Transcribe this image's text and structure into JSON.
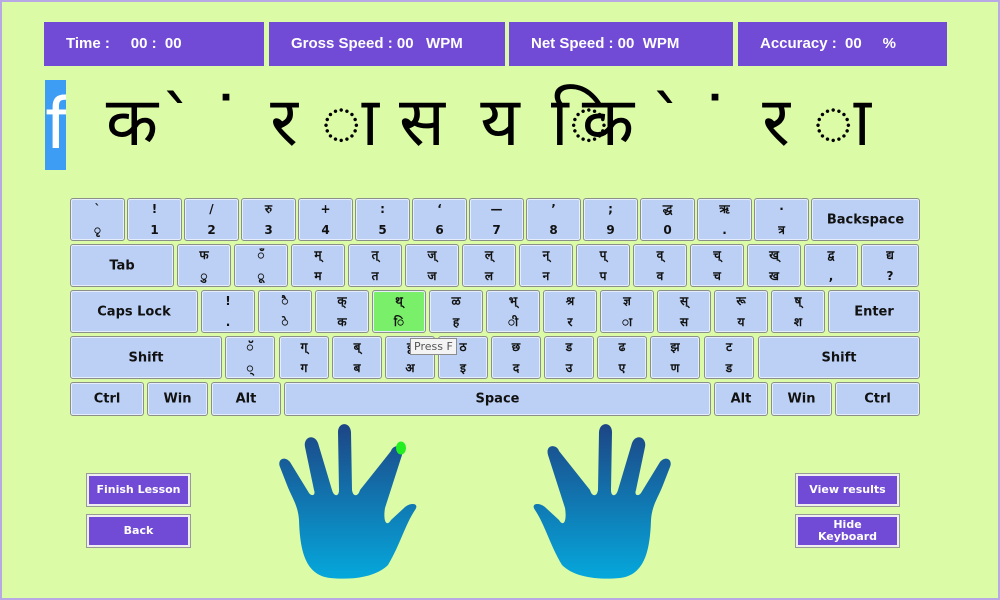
{
  "stats": {
    "time": "Time :     00 :  00",
    "gross_speed": "Gross Speed : 00   WPM",
    "net_speed": "Net Speed : 00  WPM",
    "accuracy": "Accuracy :  00     %"
  },
  "lesson": {
    "current_char": "f",
    "chars": [
      "क",
      "`",
      "˙",
      "र",
      "ा",
      "स",
      "य",
      "ि",
      "क",
      "`",
      "˙",
      "र",
      "ा"
    ]
  },
  "keyboard": {
    "highlighted_key": "थ्/ि",
    "rows": [
      [
        [
          "`",
          "ृ"
        ],
        [
          "!",
          "1"
        ],
        [
          "/",
          "2"
        ],
        [
          "रु",
          "3"
        ],
        [
          "+",
          "4"
        ],
        [
          ":",
          "5"
        ],
        [
          "‘",
          "6"
        ],
        [
          "—",
          "7"
        ],
        [
          "’",
          "8"
        ],
        [
          ";",
          "9"
        ],
        [
          "द्ध",
          "0"
        ],
        [
          "ऋ",
          "."
        ],
        [
          "·",
          "त्र"
        ],
        [
          "Backspace"
        ]
      ],
      [
        [
          "Tab"
        ],
        [
          "फ",
          "ु"
        ],
        [
          "ँ",
          "ू"
        ],
        [
          "म्",
          "म"
        ],
        [
          "त्",
          "त"
        ],
        [
          "ज्",
          "ज"
        ],
        [
          "ल्",
          "ल"
        ],
        [
          "न्",
          "न"
        ],
        [
          "प्",
          "प"
        ],
        [
          "व्",
          "व"
        ],
        [
          "च्",
          "च"
        ],
        [
          "ख्",
          "ख"
        ],
        [
          "द्व",
          ","
        ],
        [
          "द्य",
          "?"
        ]
      ],
      [
        [
          "Caps Lock"
        ],
        [
          "!",
          "."
        ],
        [
          "ै",
          "े"
        ],
        [
          "क्",
          "क"
        ],
        [
          "थ्",
          "ि"
        ],
        [
          "ळ",
          "ह"
        ],
        [
          "भ्",
          "ी"
        ],
        [
          "श्र",
          "र"
        ],
        [
          "ज्ञ",
          "ा"
        ],
        [
          "स्",
          "स"
        ],
        [
          "रू",
          "य"
        ],
        [
          "ष्",
          "श"
        ],
        [
          "Enter"
        ]
      ],
      [
        [
          "Shift"
        ],
        [
          "ॅ",
          "्"
        ],
        [
          "ग्",
          "ग"
        ],
        [
          "ब्",
          "ब"
        ],
        [
          "ट्ट",
          "अ"
        ],
        [
          "ठ",
          "इ"
        ],
        [
          "छ",
          "द"
        ],
        [
          "ड",
          "उ"
        ],
        [
          "ढ",
          "ए"
        ],
        [
          "झ",
          "ण"
        ],
        [
          "ट",
          "ड"
        ],
        [
          "Shift"
        ]
      ],
      [
        [
          "Ctrl"
        ],
        [
          "Win"
        ],
        [
          "Alt"
        ],
        [
          "Space"
        ],
        [
          "Alt"
        ],
        [
          "Win"
        ],
        [
          "Ctrl"
        ]
      ]
    ],
    "tooltip": "Press F"
  },
  "buttons": {
    "finish_lesson": "Finish Lesson",
    "back": "Back",
    "view_results": "View results",
    "hide_keyboard": "Hide Keyboard"
  },
  "colors": {
    "background": "#dcfba6",
    "accent": "#714bd6",
    "key": "#bcd0f5",
    "key_highlight": "#7af06a",
    "finger_indicator": "#22ee22"
  }
}
